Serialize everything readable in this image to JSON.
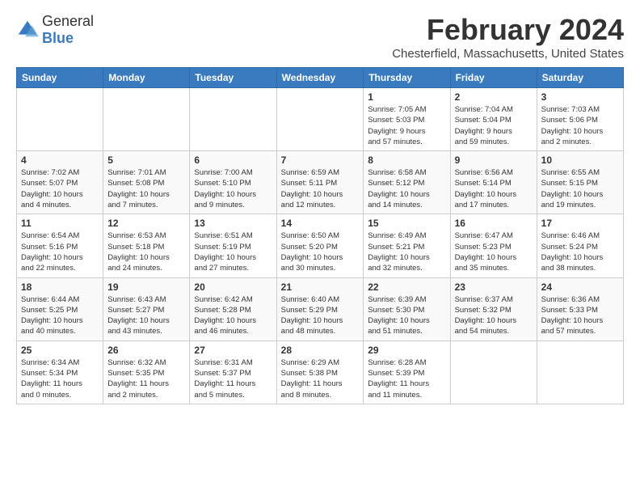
{
  "logo": {
    "text_general": "General",
    "text_blue": "Blue"
  },
  "header": {
    "month_year": "February 2024",
    "location": "Chesterfield, Massachusetts, United States"
  },
  "weekdays": [
    "Sunday",
    "Monday",
    "Tuesday",
    "Wednesday",
    "Thursday",
    "Friday",
    "Saturday"
  ],
  "rows": [
    {
      "cells": [
        {
          "day": "",
          "info": ""
        },
        {
          "day": "",
          "info": ""
        },
        {
          "day": "",
          "info": ""
        },
        {
          "day": "",
          "info": ""
        },
        {
          "day": "1",
          "info": "Sunrise: 7:05 AM\nSunset: 5:03 PM\nDaylight: 9 hours\nand 57 minutes."
        },
        {
          "day": "2",
          "info": "Sunrise: 7:04 AM\nSunset: 5:04 PM\nDaylight: 9 hours\nand 59 minutes."
        },
        {
          "day": "3",
          "info": "Sunrise: 7:03 AM\nSunset: 5:06 PM\nDaylight: 10 hours\nand 2 minutes."
        }
      ]
    },
    {
      "cells": [
        {
          "day": "4",
          "info": "Sunrise: 7:02 AM\nSunset: 5:07 PM\nDaylight: 10 hours\nand 4 minutes."
        },
        {
          "day": "5",
          "info": "Sunrise: 7:01 AM\nSunset: 5:08 PM\nDaylight: 10 hours\nand 7 minutes."
        },
        {
          "day": "6",
          "info": "Sunrise: 7:00 AM\nSunset: 5:10 PM\nDaylight: 10 hours\nand 9 minutes."
        },
        {
          "day": "7",
          "info": "Sunrise: 6:59 AM\nSunset: 5:11 PM\nDaylight: 10 hours\nand 12 minutes."
        },
        {
          "day": "8",
          "info": "Sunrise: 6:58 AM\nSunset: 5:12 PM\nDaylight: 10 hours\nand 14 minutes."
        },
        {
          "day": "9",
          "info": "Sunrise: 6:56 AM\nSunset: 5:14 PM\nDaylight: 10 hours\nand 17 minutes."
        },
        {
          "day": "10",
          "info": "Sunrise: 6:55 AM\nSunset: 5:15 PM\nDaylight: 10 hours\nand 19 minutes."
        }
      ]
    },
    {
      "cells": [
        {
          "day": "11",
          "info": "Sunrise: 6:54 AM\nSunset: 5:16 PM\nDaylight: 10 hours\nand 22 minutes."
        },
        {
          "day": "12",
          "info": "Sunrise: 6:53 AM\nSunset: 5:18 PM\nDaylight: 10 hours\nand 24 minutes."
        },
        {
          "day": "13",
          "info": "Sunrise: 6:51 AM\nSunset: 5:19 PM\nDaylight: 10 hours\nand 27 minutes."
        },
        {
          "day": "14",
          "info": "Sunrise: 6:50 AM\nSunset: 5:20 PM\nDaylight: 10 hours\nand 30 minutes."
        },
        {
          "day": "15",
          "info": "Sunrise: 6:49 AM\nSunset: 5:21 PM\nDaylight: 10 hours\nand 32 minutes."
        },
        {
          "day": "16",
          "info": "Sunrise: 6:47 AM\nSunset: 5:23 PM\nDaylight: 10 hours\nand 35 minutes."
        },
        {
          "day": "17",
          "info": "Sunrise: 6:46 AM\nSunset: 5:24 PM\nDaylight: 10 hours\nand 38 minutes."
        }
      ]
    },
    {
      "cells": [
        {
          "day": "18",
          "info": "Sunrise: 6:44 AM\nSunset: 5:25 PM\nDaylight: 10 hours\nand 40 minutes."
        },
        {
          "day": "19",
          "info": "Sunrise: 6:43 AM\nSunset: 5:27 PM\nDaylight: 10 hours\nand 43 minutes."
        },
        {
          "day": "20",
          "info": "Sunrise: 6:42 AM\nSunset: 5:28 PM\nDaylight: 10 hours\nand 46 minutes."
        },
        {
          "day": "21",
          "info": "Sunrise: 6:40 AM\nSunset: 5:29 PM\nDaylight: 10 hours\nand 48 minutes."
        },
        {
          "day": "22",
          "info": "Sunrise: 6:39 AM\nSunset: 5:30 PM\nDaylight: 10 hours\nand 51 minutes."
        },
        {
          "day": "23",
          "info": "Sunrise: 6:37 AM\nSunset: 5:32 PM\nDaylight: 10 hours\nand 54 minutes."
        },
        {
          "day": "24",
          "info": "Sunrise: 6:36 AM\nSunset: 5:33 PM\nDaylight: 10 hours\nand 57 minutes."
        }
      ]
    },
    {
      "cells": [
        {
          "day": "25",
          "info": "Sunrise: 6:34 AM\nSunset: 5:34 PM\nDaylight: 11 hours\nand 0 minutes."
        },
        {
          "day": "26",
          "info": "Sunrise: 6:32 AM\nSunset: 5:35 PM\nDaylight: 11 hours\nand 2 minutes."
        },
        {
          "day": "27",
          "info": "Sunrise: 6:31 AM\nSunset: 5:37 PM\nDaylight: 11 hours\nand 5 minutes."
        },
        {
          "day": "28",
          "info": "Sunrise: 6:29 AM\nSunset: 5:38 PM\nDaylight: 11 hours\nand 8 minutes."
        },
        {
          "day": "29",
          "info": "Sunrise: 6:28 AM\nSunset: 5:39 PM\nDaylight: 11 hours\nand 11 minutes."
        },
        {
          "day": "",
          "info": ""
        },
        {
          "day": "",
          "info": ""
        }
      ]
    }
  ]
}
